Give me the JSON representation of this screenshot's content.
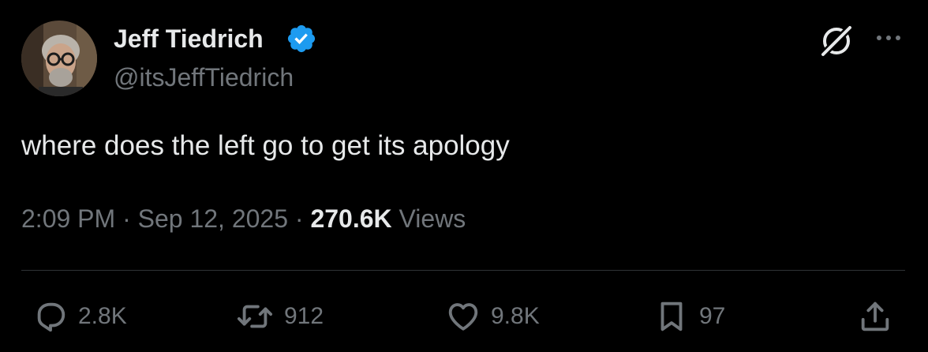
{
  "author": {
    "display_name": "Jeff Tiedrich",
    "handle": "@itsJeffTiedrich",
    "verified": true,
    "avatar_icon": "avatar-photo"
  },
  "tweet": {
    "text": "where does the left go to get its apology",
    "time": "2:09 PM",
    "date": "Sep 12, 2025",
    "separator": "·",
    "views_count": "270.6K",
    "views_label": "Views"
  },
  "header_icons": [
    "grok-icon",
    "more-icon"
  ],
  "actions": {
    "replies": "2.8K",
    "reposts": "912",
    "likes": "9.8K",
    "bookmarks": "97"
  },
  "colors": {
    "background": "#000000",
    "primary_text": "#e7e9ea",
    "secondary_text": "#71767b",
    "verified_badge": "#1d9bf0",
    "divider": "#2f3336"
  }
}
